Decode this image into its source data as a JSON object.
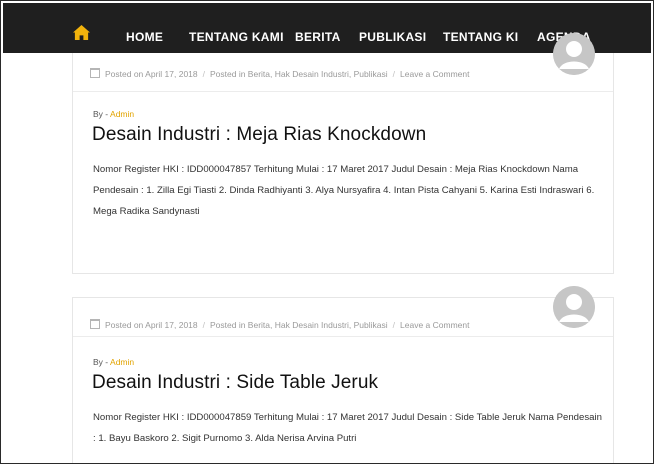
{
  "nav": {
    "home_icon": "home-icon",
    "items": [
      "HOME",
      "TENTANG KAMI",
      "BERITA",
      "PUBLIKASI",
      "TENTANG KI",
      "AGENDA"
    ],
    "accent": "#f2b30c",
    "background": "#1f1f1f"
  },
  "posts": [
    {
      "posted": "Posted on April 17, 2018",
      "categories": "Posted in Berita, Hak Desain Industri, Publikasi",
      "comment": "Leave a Comment",
      "by": "By -",
      "author": "Admin",
      "title": "Desain Industri : Meja Rias Knockdown",
      "excerpt": "Nomor Register HKI : IDD000047857 Terhitung Mulai : 17 Maret 2017 Judul Desain : Meja Rias Knockdown Nama Pendesain : 1. Zilla Egi Tiasti 2. Dinda Radhiyanti 3. Alya Nursyafira 4. Intan Pista Cahyani 5. Karina Esti Indraswari 6. Mega Radika Sandynasti"
    },
    {
      "posted": "Posted on April 17, 2018",
      "categories": "Posted in Berita, Hak Desain Industri, Publikasi",
      "comment": "Leave a Comment",
      "by": "By -",
      "author": "Admin",
      "title": "Desain Industri : Side Table Jeruk",
      "excerpt": "Nomor Register HKI : IDD000047859 Terhitung Mulai : 17 Maret 2017 Judul Desain : Side Table Jeruk Nama Pendesain : 1. Bayu Baskoro 2. Sigit Purnomo 3. Alda Nerisa Arvina Putri"
    }
  ]
}
